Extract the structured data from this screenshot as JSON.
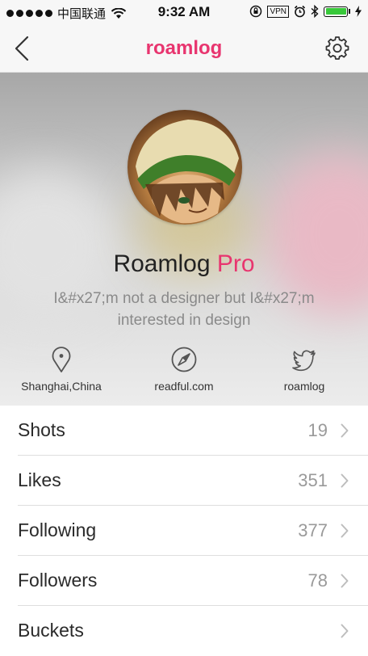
{
  "status_bar": {
    "carrier": "中国联通",
    "time": "9:32 AM",
    "vpn": "VPN",
    "battery_color": "#38c93a"
  },
  "nav": {
    "title": "roamlog",
    "title_color": "#e8356f"
  },
  "profile": {
    "name": "Roamlog",
    "badge": "Pro",
    "bio": "I&#x27;m not a designer but I&#x27;m interested in design",
    "location": "Shanghai,China",
    "website": "readful.com",
    "twitter": "roamlog"
  },
  "menu": [
    {
      "label": "Shots",
      "count": "19"
    },
    {
      "label": "Likes",
      "count": "351"
    },
    {
      "label": "Following",
      "count": "377"
    },
    {
      "label": "Followers",
      "count": "78"
    },
    {
      "label": "Buckets",
      "count": ""
    }
  ]
}
